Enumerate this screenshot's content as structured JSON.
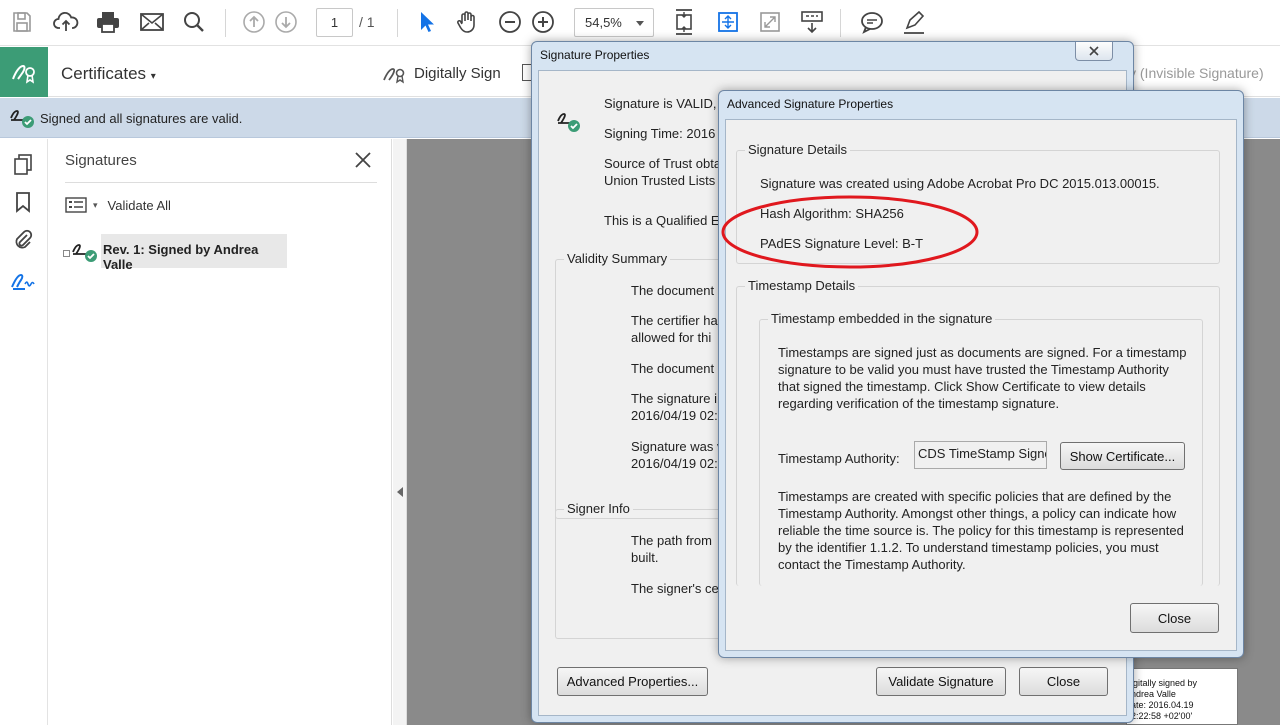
{
  "toolbar": {
    "page_current": "1",
    "page_total": "/ 1",
    "zoom": "54,5%"
  },
  "cert_bar": {
    "title": "Certificates",
    "digitally_sign": "Digitally Sign",
    "invisible_signature": "y (Invisible Signature)"
  },
  "status": {
    "text": "Signed and all signatures are valid."
  },
  "panel": {
    "title": "Signatures",
    "validate_all": "Validate All",
    "signature_item": "Rev. 1: Signed by Andrea Valle"
  },
  "pdf_stamp": {
    "lines": [
      "igitally signed by",
      "ndrea Valle",
      "ate: 2016.04.19",
      "2:22:58 +02'00'"
    ]
  },
  "sig_props": {
    "title": "Signature Properties",
    "valid_line": "Signature is VALID,",
    "signing_time": "Signing Time:  2016",
    "source_trust_1": "Source of Trust obta",
    "source_trust_2": "Union Trusted Lists (",
    "qualified": "This is a Qualified E",
    "validity_summary": "Validity Summary",
    "vs_lines": [
      "The document",
      "The certifier ha",
      "allowed for thi",
      "The document",
      "The signature i",
      "2016/04/19 02:",
      "Signature was v",
      "2016/04/19 02:"
    ],
    "signer_info": "Signer Info",
    "si_lines": [
      "The path from",
      "built.",
      "The signer's cer"
    ],
    "advanced_btn": "Advanced Properties...",
    "validate_btn": "Validate Signature",
    "close_btn": "Close"
  },
  "adv": {
    "title": "Advanced Signature Properties",
    "sig_details": "Signature Details",
    "created": "Signature was created using Adobe Acrobat Pro DC 2015.013.00015.",
    "hash": "Hash Algorithm: SHA256",
    "pades": "PAdES Signature Level: B-T",
    "ts_details": "Timestamp Details",
    "ts_embedded": "Timestamp embedded in the signature",
    "ts_para1": "Timestamps are signed just as documents are signed. For a timestamp signature to be valid you must have trusted the Timestamp Authority that signed the timestamp. Click Show Certificate to view details regarding verification of the timestamp signature.",
    "ts_authority_label": "Timestamp Authority:",
    "ts_authority_value": "CDS TimeStamp Signe",
    "show_cert": "Show Certificate...",
    "ts_para2": "Timestamps are created with specific policies that are defined by the Timestamp Authority. Amongst other things, a policy can indicate how reliable the time source is. The policy for this timestamp is represented by the identifier 1.1.2. To understand timestamp policies, you must contact the Timestamp Authority.",
    "close": "Close"
  },
  "colors": {
    "accent_green": "#3c9c76",
    "status_bar": "#ccd9e8",
    "tool_blue": "#1473e6",
    "annotation_red": "#e0181e"
  }
}
